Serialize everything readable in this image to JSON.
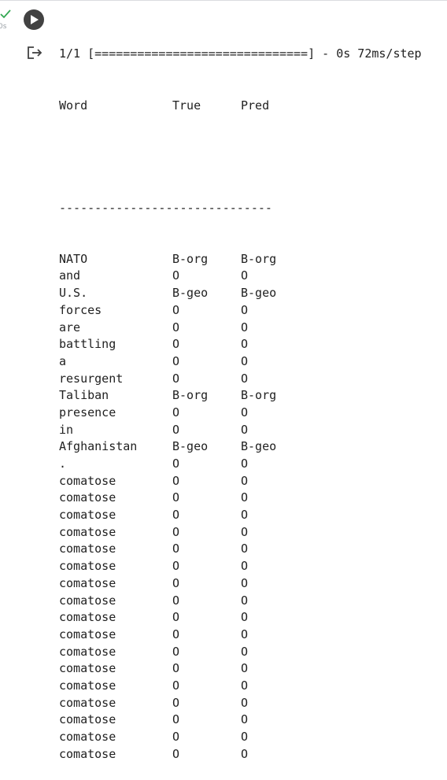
{
  "cell": {
    "exec_time": "0s"
  },
  "progress": "1/1 [==============================] - 0s 72ms/step",
  "table": {
    "headers": [
      "Word",
      "True",
      "Pred"
    ],
    "separator": "------------------------------",
    "rows": [
      [
        "NATO",
        "B-org",
        "B-org"
      ],
      [
        "and",
        "O",
        "O"
      ],
      [
        "U.S.",
        "B-geo",
        "B-geo"
      ],
      [
        "forces",
        "O",
        "O"
      ],
      [
        "are",
        "O",
        "O"
      ],
      [
        "battling",
        "O",
        "O"
      ],
      [
        "a",
        "O",
        "O"
      ],
      [
        "resurgent",
        "O",
        "O"
      ],
      [
        "Taliban",
        "B-org",
        "B-org"
      ],
      [
        "presence",
        "O",
        "O"
      ],
      [
        "in",
        "O",
        "O"
      ],
      [
        "Afghanistan",
        "B-geo",
        "B-geo"
      ],
      [
        ".",
        "O",
        "O"
      ],
      [
        "comatose",
        "O",
        "O"
      ],
      [
        "comatose",
        "O",
        "O"
      ],
      [
        "comatose",
        "O",
        "O"
      ],
      [
        "comatose",
        "O",
        "O"
      ],
      [
        "comatose",
        "O",
        "O"
      ],
      [
        "comatose",
        "O",
        "O"
      ],
      [
        "comatose",
        "O",
        "O"
      ],
      [
        "comatose",
        "O",
        "O"
      ],
      [
        "comatose",
        "O",
        "O"
      ],
      [
        "comatose",
        "O",
        "O"
      ],
      [
        "comatose",
        "O",
        "O"
      ],
      [
        "comatose",
        "O",
        "O"
      ],
      [
        "comatose",
        "O",
        "O"
      ],
      [
        "comatose",
        "O",
        "O"
      ],
      [
        "comatose",
        "O",
        "O"
      ],
      [
        "comatose",
        "O",
        "O"
      ],
      [
        "comatose",
        "O",
        "O"
      ]
    ]
  },
  "colors": {
    "success": "#34a853",
    "run_button": "#424242"
  },
  "icons": {
    "status": "checkmark-icon",
    "run": "play-icon",
    "output": "output-redirect-icon"
  }
}
